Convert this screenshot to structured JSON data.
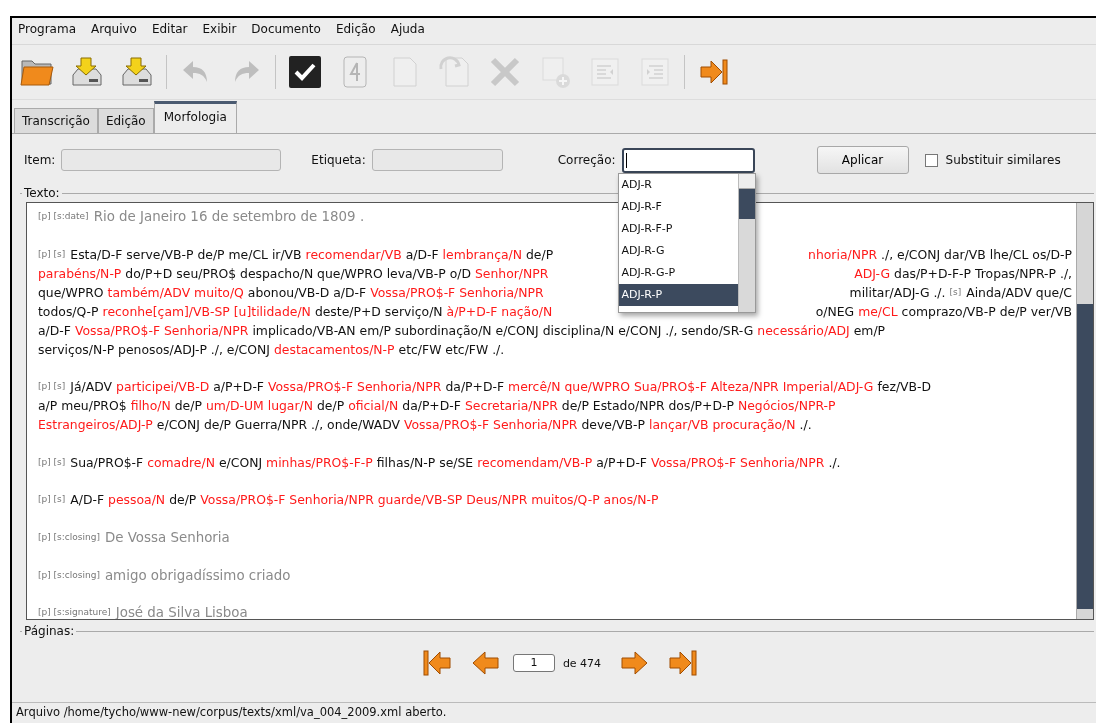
{
  "menu": [
    "Programa",
    "Arquivo",
    "Editar",
    "Exibir",
    "Documento",
    "Edição",
    "Ajuda"
  ],
  "toolbar": [
    {
      "kind": "folder",
      "disabled": false
    },
    {
      "kind": "drive-down",
      "disabled": false
    },
    {
      "kind": "drive-down",
      "disabled": false
    },
    {
      "kind": "sep"
    },
    {
      "kind": "undo",
      "disabled": true
    },
    {
      "kind": "redo",
      "disabled": true
    },
    {
      "kind": "sep"
    },
    {
      "kind": "check",
      "disabled": false
    },
    {
      "kind": "page",
      "disabled": true
    },
    {
      "kind": "doc",
      "disabled": true
    },
    {
      "kind": "doc-back",
      "disabled": true
    },
    {
      "kind": "cross",
      "disabled": true
    },
    {
      "kind": "add",
      "disabled": true
    },
    {
      "kind": "indent-left",
      "disabled": true
    },
    {
      "kind": "indent-right",
      "disabled": true
    },
    {
      "kind": "sep"
    },
    {
      "kind": "exit",
      "disabled": false
    }
  ],
  "tabs": [
    {
      "label": "Transcrição",
      "selected": false
    },
    {
      "label": "Edição",
      "selected": false
    },
    {
      "label": "Morfologia",
      "selected": true
    }
  ],
  "form": {
    "item_label": "Item:",
    "etiqueta_label": "Etiqueta:",
    "correcao_label": "Correção:",
    "apply_button": "Aplicar",
    "similar_checkbox": {
      "label": "Substituir similares",
      "checked": false
    }
  },
  "suggestions": [
    {
      "label": "ADJ-R",
      "selected": false
    },
    {
      "label": "ADJ-R-F",
      "selected": false
    },
    {
      "label": "ADJ-R-F-P",
      "selected": false
    },
    {
      "label": "ADJ-R-G",
      "selected": false
    },
    {
      "label": "ADJ-R-G-P",
      "selected": false
    },
    {
      "label": "ADJ-R-P",
      "selected": true
    }
  ],
  "text_panel": {
    "legend": "Texto:",
    "paragraphs": [
      {
        "lines": [
          {
            "left": [
              {
                "kind": "tag",
                "text": "[p] [s:date]"
              },
              {
                "kind": "gray",
                "text": "Rio de Janeiro 16 de setembro de 1809 ."
              }
            ]
          }
        ]
      },
      {
        "lines": [
          {
            "left": [
              {
                "kind": "tag",
                "text": "[p] [s]"
              },
              {
                "kind": "plain",
                "text": "Esta/D-F serve/VB-P de/P me/CL ir/VB"
              },
              {
                "kind": "red",
                "text": "recomendar/VB"
              },
              {
                "kind": "plain",
                "text": "a/D-F"
              },
              {
                "kind": "red",
                "text": "lembrança/N"
              },
              {
                "kind": "plain",
                "text": "de/P"
              }
            ],
            "right": [
              {
                "kind": "red",
                "text": "nhoria/NPR"
              },
              {
                "kind": "plain",
                "text": "./, e/CONJ dar/VB lhe/CL os/D-P"
              }
            ]
          },
          {
            "left": [
              {
                "kind": "red",
                "text": "parabéns/N-P"
              },
              {
                "kind": "plain",
                "text": "do/P+D seu/PRO$ despacho/N que/WPRO leva/VB-P o/D"
              },
              {
                "kind": "red",
                "text": "Senhor/NPR"
              }
            ],
            "right": [
              {
                "kind": "red",
                "text": "ADJ-G"
              },
              {
                "kind": "plain",
                "text": "das/P+D-F-P Tropas/NPR-P ./,"
              }
            ]
          },
          {
            "left": [
              {
                "kind": "plain",
                "text": "que/WPRO"
              },
              {
                "kind": "red",
                "text": "também/ADV muito/Q"
              },
              {
                "kind": "plain",
                "text": "abonou/VB-D a/D-F"
              },
              {
                "kind": "red",
                "text": "Vossa/PRO$-F Senhoria/NPR"
              }
            ],
            "right": [
              {
                "kind": "plain",
                "text": "militar/ADJ-G ./."
              },
              {
                "kind": "tag",
                "text": "[s]"
              },
              {
                "kind": "plain",
                "text": "Ainda/ADV que/C"
              }
            ]
          },
          {
            "left": [
              {
                "kind": "plain",
                "text": "todos/Q-P"
              },
              {
                "kind": "red",
                "text": "reconhe[çam]/VB-SP [u]tilidade/N"
              },
              {
                "kind": "plain",
                "text": "deste/P+D serviço/N"
              },
              {
                "kind": "red",
                "text": "à/P+D-F nação/N"
              }
            ],
            "right": [
              {
                "kind": "plain",
                "text": "o/NEG"
              },
              {
                "kind": "red",
                "text": "me/CL"
              },
              {
                "kind": "plain",
                "text": "comprazo/VB-P de/P ver/VB"
              }
            ]
          },
          {
            "left": [
              {
                "kind": "plain",
                "text": "a/D-F"
              },
              {
                "kind": "red",
                "text": "Vossa/PRO$-F Senhoria/NPR"
              },
              {
                "kind": "plain",
                "text": "implicado/VB-AN em/P subordinação/N e/CONJ disciplina/N e/CONJ ./, sendo/SR-G"
              },
              {
                "kind": "red",
                "text": "necessário/ADJ"
              },
              {
                "kind": "plain",
                "text": "em/P"
              }
            ]
          },
          {
            "left": [
              {
                "kind": "plain",
                "text": "serviços/N-P penosos/ADJ-P ./, e/CONJ"
              },
              {
                "kind": "red",
                "text": "destacamentos/N-P"
              },
              {
                "kind": "plain",
                "text": "etc/FW etc/FW ./."
              }
            ]
          }
        ]
      },
      {
        "lines": [
          {
            "left": [
              {
                "kind": "tag",
                "text": "[p] [s]"
              },
              {
                "kind": "plain",
                "text": "Já/ADV"
              },
              {
                "kind": "red",
                "text": "participei/VB-D"
              },
              {
                "kind": "plain",
                "text": "a/P+D-F"
              },
              {
                "kind": "red",
                "text": "Vossa/PRO$-F Senhoria/NPR"
              },
              {
                "kind": "plain",
                "text": "da/P+D-F"
              },
              {
                "kind": "red",
                "text": "mercê/N que/WPRO Sua/PRO$-F Alteza/NPR Imperial/ADJ-G"
              },
              {
                "kind": "plain",
                "text": "fez/VB-D"
              }
            ]
          },
          {
            "left": [
              {
                "kind": "plain",
                "text": "a/P meu/PRO$"
              },
              {
                "kind": "red",
                "text": "filho/N"
              },
              {
                "kind": "plain",
                "text": "de/P"
              },
              {
                "kind": "red",
                "text": "um/D-UM lugar/N"
              },
              {
                "kind": "plain",
                "text": "de/P"
              },
              {
                "kind": "red",
                "text": "oficial/N"
              },
              {
                "kind": "plain",
                "text": "da/P+D-F"
              },
              {
                "kind": "red",
                "text": "Secretaria/NPR"
              },
              {
                "kind": "plain",
                "text": "de/P Estado/NPR dos/P+D-P"
              },
              {
                "kind": "red",
                "text": "Negócios/NPR-P"
              }
            ]
          },
          {
            "left": [
              {
                "kind": "red",
                "text": "Estrangeiros/ADJ-P"
              },
              {
                "kind": "plain",
                "text": "e/CONJ de/P Guerra/NPR ./, onde/WADV"
              },
              {
                "kind": "red",
                "text": "Vossa/PRO$-F Senhoria/NPR"
              },
              {
                "kind": "plain",
                "text": "deve/VB-P"
              },
              {
                "kind": "red",
                "text": "lançar/VB procuração/N"
              },
              {
                "kind": "plain",
                "text": "./."
              }
            ]
          }
        ]
      },
      {
        "lines": [
          {
            "left": [
              {
                "kind": "tag",
                "text": "[p] [s]"
              },
              {
                "kind": "plain",
                "text": "Sua/PRO$-F"
              },
              {
                "kind": "red",
                "text": "comadre/N"
              },
              {
                "kind": "plain",
                "text": "e/CONJ"
              },
              {
                "kind": "red",
                "text": "minhas/PRO$-F-P"
              },
              {
                "kind": "plain",
                "text": "filhas/N-P se/SE"
              },
              {
                "kind": "red",
                "text": "recomendam/VB-P"
              },
              {
                "kind": "plain",
                "text": "a/P+D-F"
              },
              {
                "kind": "red",
                "text": "Vossa/PRO$-F Senhoria/NPR"
              },
              {
                "kind": "plain",
                "text": "./."
              }
            ]
          }
        ]
      },
      {
        "lines": [
          {
            "left": [
              {
                "kind": "tag",
                "text": "[p] [s]"
              },
              {
                "kind": "plain",
                "text": "A/D-F"
              },
              {
                "kind": "red",
                "text": "pessoa/N"
              },
              {
                "kind": "plain",
                "text": "de/P"
              },
              {
                "kind": "red",
                "text": "Vossa/PRO$-F Senhoria/NPR guarde/VB-SP Deus/NPR muitos/Q-P anos/N-P"
              }
            ]
          }
        ]
      },
      {
        "lines": [
          {
            "left": [
              {
                "kind": "tag",
                "text": "[p] [s:closing]"
              },
              {
                "kind": "gray",
                "text": "De Vossa Senhoria"
              }
            ]
          }
        ]
      },
      {
        "lines": [
          {
            "left": [
              {
                "kind": "tag",
                "text": "[p] [s:closing]"
              },
              {
                "kind": "gray",
                "text": "amigo obrigadíssimo criado"
              }
            ]
          }
        ]
      },
      {
        "lines": [
          {
            "left": [
              {
                "kind": "tag",
                "text": "[p] [s:signature]"
              },
              {
                "kind": "gray",
                "text": "José da Silva Lisboa"
              }
            ]
          }
        ]
      }
    ]
  },
  "pages": {
    "legend": "Páginas:",
    "page": "1",
    "of_label": "de 474"
  },
  "status_bar": "Arquivo /home/tycho/www-new/corpus/texts/xml/va_004_2009.xml aberto."
}
